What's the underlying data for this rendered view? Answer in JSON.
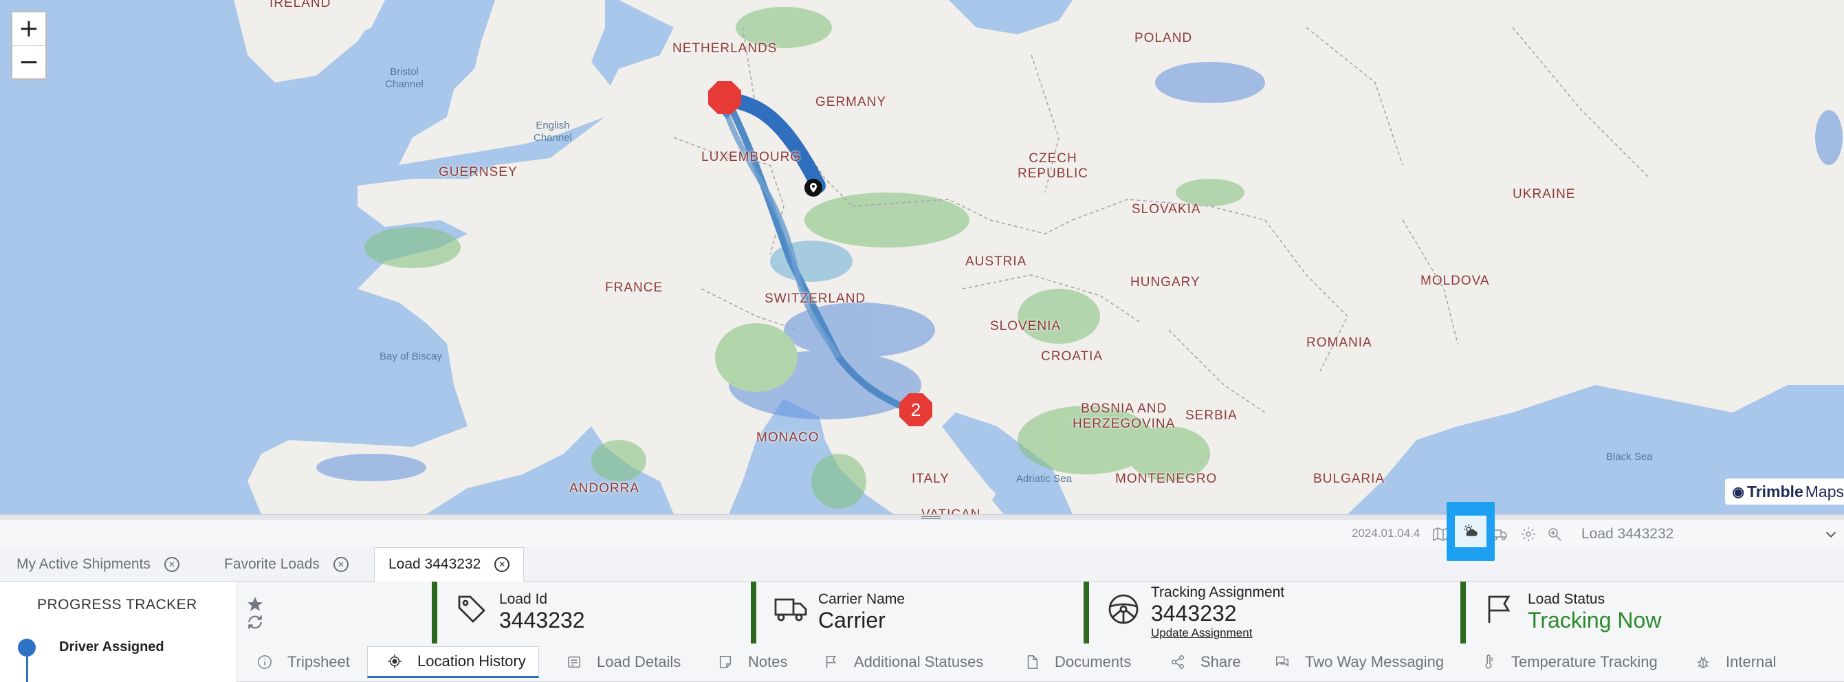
{
  "map": {
    "zoom_in": "+",
    "zoom_out": "−",
    "places": {
      "ireland": "IRELAND",
      "netherlands": "NETHERLANDS",
      "germany": "GERMANY",
      "luxembourg": "LUXEMBOURG",
      "poland": "POLAND",
      "czech": "CZECH\nREPUBLIC",
      "ukraine": "UKRAINE",
      "slovakia": "SLOVAKIA",
      "austria": "AUSTRIA",
      "hungary": "HUNGARY",
      "moldova": "MOLDOVA",
      "france": "FRANCE",
      "switzerland": "SWITZERLAND",
      "slovenia": "SLOVENIA",
      "croatia": "CROATIA",
      "romania": "ROMANIA",
      "bosnia": "BOSNIA AND\nHERZEGOVINA",
      "serbia": "SERBIA",
      "monaco": "MONACO",
      "italy": "ITALY",
      "montenegro": "MONTENEGRO",
      "bulgaria": "BULGARIA",
      "andorra": "ANDORRA",
      "guernsey": "GUERNSEY",
      "vatican": "VATICAN"
    },
    "seas": {
      "bristol": "Bristol\nChannel",
      "english": "English\nChannel",
      "biscay": "Bay of Biscay",
      "adriatic": "Adriatic Sea",
      "black": "Black Sea"
    },
    "stop_number": "2",
    "brand_name": "Trimble",
    "brand_suffix": "Maps"
  },
  "toolbar": {
    "version": "2024.01.04.4",
    "icons": [
      "map-icon",
      "weather-icon",
      "truck-icon",
      "settings-icon",
      "zoom-icon"
    ],
    "load_selector": "Load 3443232"
  },
  "tabs": [
    {
      "label": "My Active Shipments"
    },
    {
      "label": "Favorite Loads"
    },
    {
      "label": "Load 3443232"
    }
  ],
  "progress": {
    "title": "PROGRESS TRACKER",
    "step": "Driver Assigned"
  },
  "summary": {
    "load_id_label": "Load Id",
    "load_id_value": "3443232",
    "carrier_label": "Carrier Name",
    "carrier_value": "Carrier",
    "tracking_label": "Tracking Assignment",
    "tracking_value": "3443232",
    "tracking_link": "Update Assignment",
    "status_label": "Load Status",
    "status_value": "Tracking Now"
  },
  "nav_tabs": [
    {
      "label": "Tripsheet",
      "icon": "info-icon"
    },
    {
      "label": "Location History",
      "icon": "target-icon"
    },
    {
      "label": "Load Details",
      "icon": "details-icon"
    },
    {
      "label": "Notes",
      "icon": "note-icon"
    },
    {
      "label": "Additional Statuses",
      "icon": "flag-icon"
    },
    {
      "label": "Documents",
      "icon": "document-icon"
    },
    {
      "label": "Share",
      "icon": "share-icon"
    },
    {
      "label": "Two Way Messaging",
      "icon": "chat-icon"
    },
    {
      "label": "Temperature Tracking",
      "icon": "thermometer-icon"
    },
    {
      "label": "Internal",
      "icon": "bug-icon"
    }
  ],
  "colors": {
    "route": "#2f6fbd",
    "route_light": "#4f8ac7",
    "marker": "#e53a35",
    "accent": "#1ea0f2",
    "card_border": "#2d6a1f",
    "status_green": "#2c8a2c"
  }
}
